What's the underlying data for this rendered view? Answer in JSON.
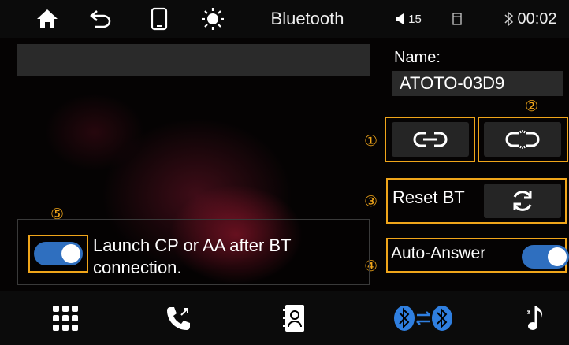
{
  "topbar": {
    "icons": [
      "home-icon",
      "back-icon",
      "phone-device-icon",
      "brightness-icon"
    ],
    "title": "Bluetooth",
    "volume": "15",
    "clock": "00:02"
  },
  "device_panel": {
    "name_label": "Name:",
    "name_value": "ATOTO-03D9"
  },
  "markers": {
    "m1": "①",
    "m2": "②",
    "m3": "③",
    "m4": "④",
    "m5": "⑤"
  },
  "buttons": {
    "connect_icon": "link-icon",
    "disconnect_icon": "unlink-icon",
    "reset_label": "Reset BT",
    "reset_icon": "refresh-icon",
    "auto_answer_label": "Auto-Answer",
    "auto_answer_on": true
  },
  "launch": {
    "text_line1": "Launch CP or AA after BT",
    "text_line2": "connection.",
    "enabled": true
  },
  "bottombar": {
    "items": [
      "dialpad-icon",
      "call-log-icon",
      "contacts-icon",
      "bt-pair-icon",
      "music-icon"
    ]
  },
  "colors": {
    "accent_orange": "#f0a51a",
    "toggle_blue": "#2f6fbf",
    "bt_blue": "#2f7fe0"
  }
}
